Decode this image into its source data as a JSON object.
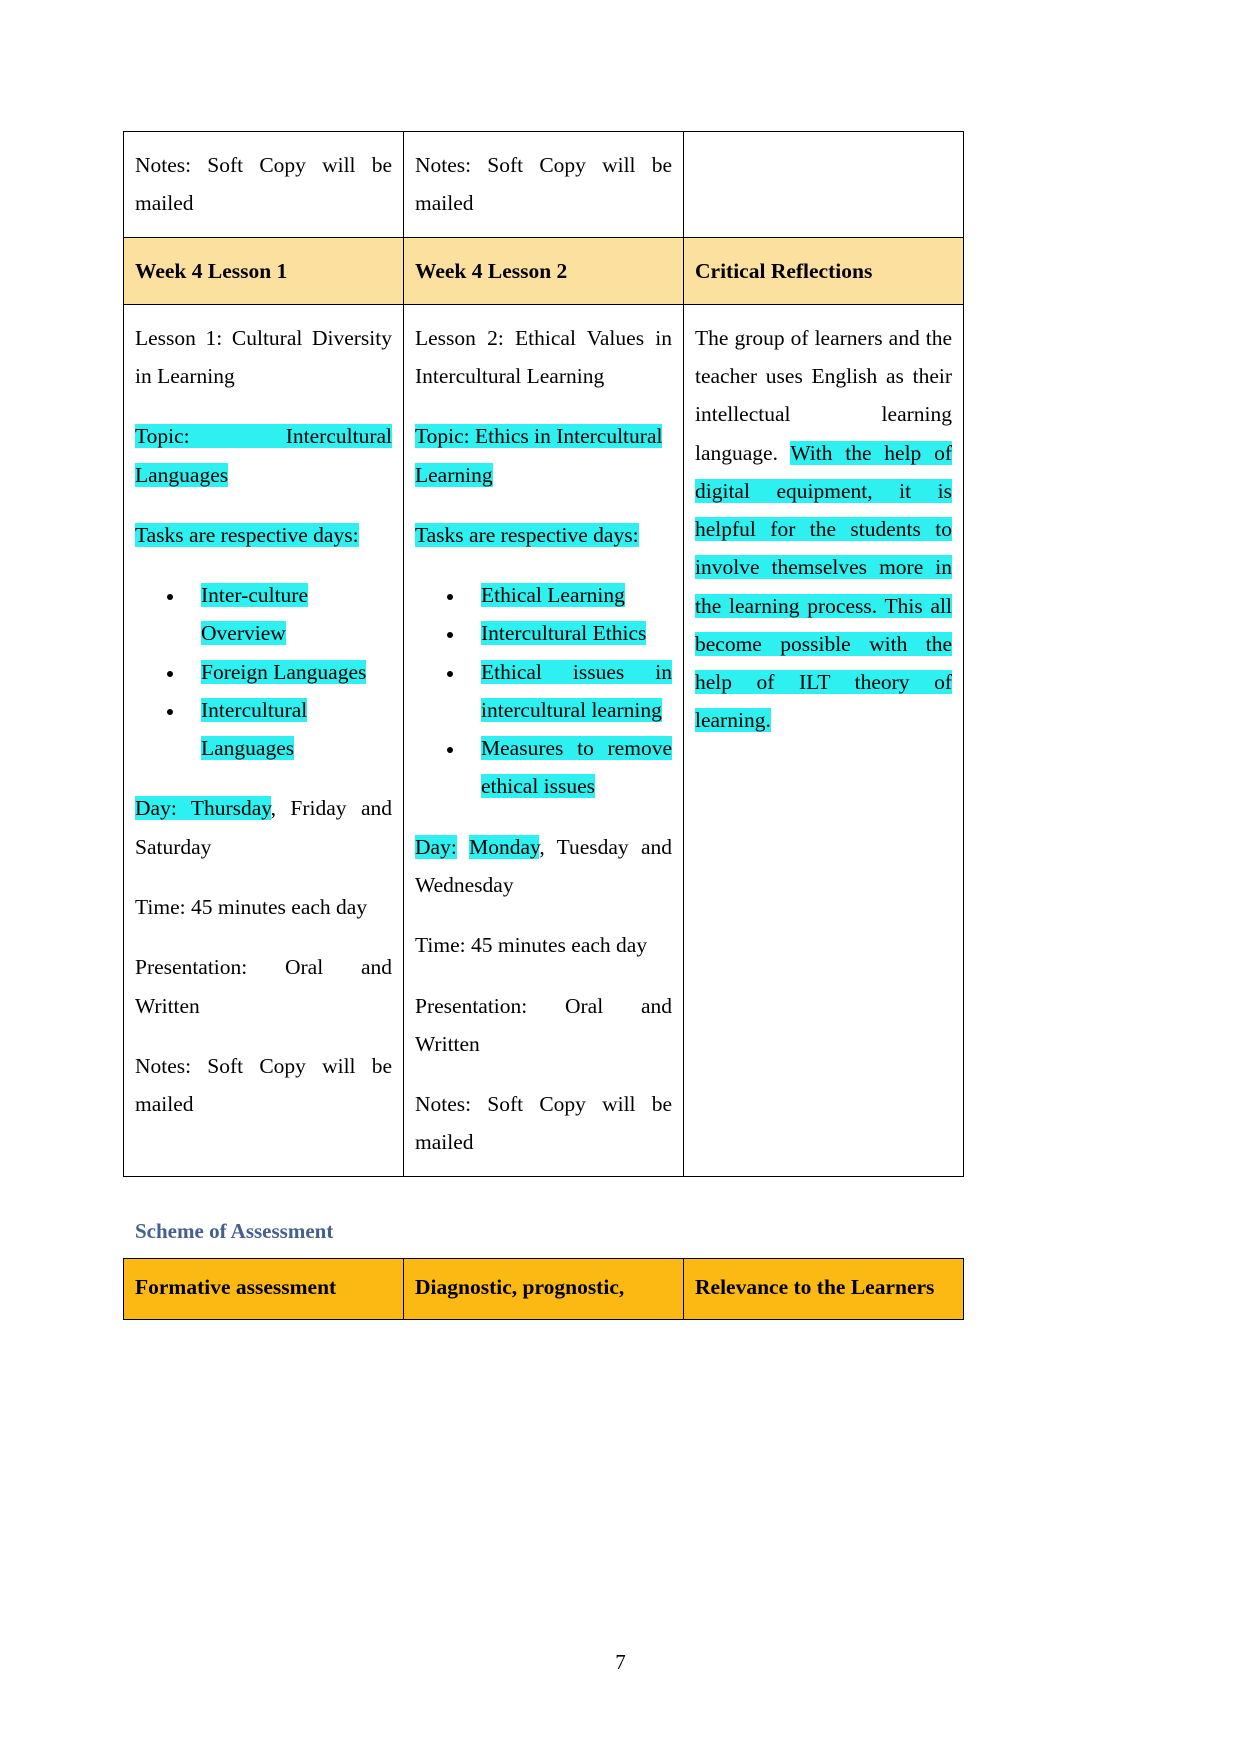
{
  "document": {
    "page_number": "7",
    "colors": {
      "header_row": "#fce0a0",
      "highlight": "#2ef0f0",
      "assessment_header": "#fcb913",
      "heading_text": "#44608e"
    }
  },
  "top_partial_row": {
    "col1": "Notes: Soft Copy will be mailed",
    "col2": "Notes: Soft Copy will be mailed",
    "col3": ""
  },
  "lesson_header": {
    "col1": "Week 4 Lesson 1",
    "col2": "Week 4 Lesson 2",
    "col3": "Critical Reflections"
  },
  "week4_lesson1": {
    "title": "Lesson 1: Cultural Diversity in Learning",
    "topic": "Topic: Intercultural Languages",
    "tasks_label": "Tasks are respective days:",
    "tasks": [
      "Inter-culture Overview",
      "Foreign Languages",
      "Intercultural Languages"
    ],
    "day_highlight": "Day: Thursday",
    "day_rest": ", Friday and Saturday",
    "time": "Time: 45 minutes each day",
    "presentation": "Presentation: Oral and Written",
    "notes": "Notes: Soft Copy will be mailed"
  },
  "week4_lesson2": {
    "title": "Lesson 2: Ethical Values in Intercultural Learning",
    "topic": "Topic: Ethics in Intercultural Learning",
    "tasks_label": "Tasks are respective days:",
    "tasks": [
      "Ethical Learning",
      "Intercultural Ethics",
      "Ethical issues in intercultural learning",
      "Measures to remove ethical issues"
    ],
    "day_label": "Day:",
    "day_highlight": "Monday",
    "day_rest": ", Tuesday and Wednesday",
    "time": "Time: 45 minutes each day",
    "presentation": "Presentation: Oral and Written",
    "notes": "Notes: Soft Copy will be mailed"
  },
  "critical_reflections": {
    "text_plain": "The group of learners and the teacher uses English as their intellectual learning language. ",
    "text_highlighted": "With the help of digital equipment, it is helpful for the students to involve themselves more in the learning process. This all become possible with the help of ILT theory of learning."
  },
  "scheme_of_assessment": {
    "heading": "Scheme of Assessment",
    "headers": [
      "Formative assessment",
      "Diagnostic, prognostic,",
      "Relevance to the Learners"
    ]
  }
}
